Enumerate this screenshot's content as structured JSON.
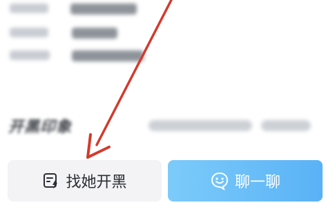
{
  "profile_info": {
    "rows_count": 3
  },
  "impressions": {
    "title": "开黑印象"
  },
  "actions": {
    "play_together_label": "找她开黑",
    "chat_label": "聊一聊"
  },
  "colors": {
    "annotation_arrow": "#d33a2c",
    "chat_button_start": "#7ccbfa",
    "chat_button_end": "#5ab2f6",
    "play_button_bg": "#f3f3f5"
  },
  "icons": {
    "play_together": "edit-lightning-icon",
    "chat": "smile-bubble-icon"
  }
}
